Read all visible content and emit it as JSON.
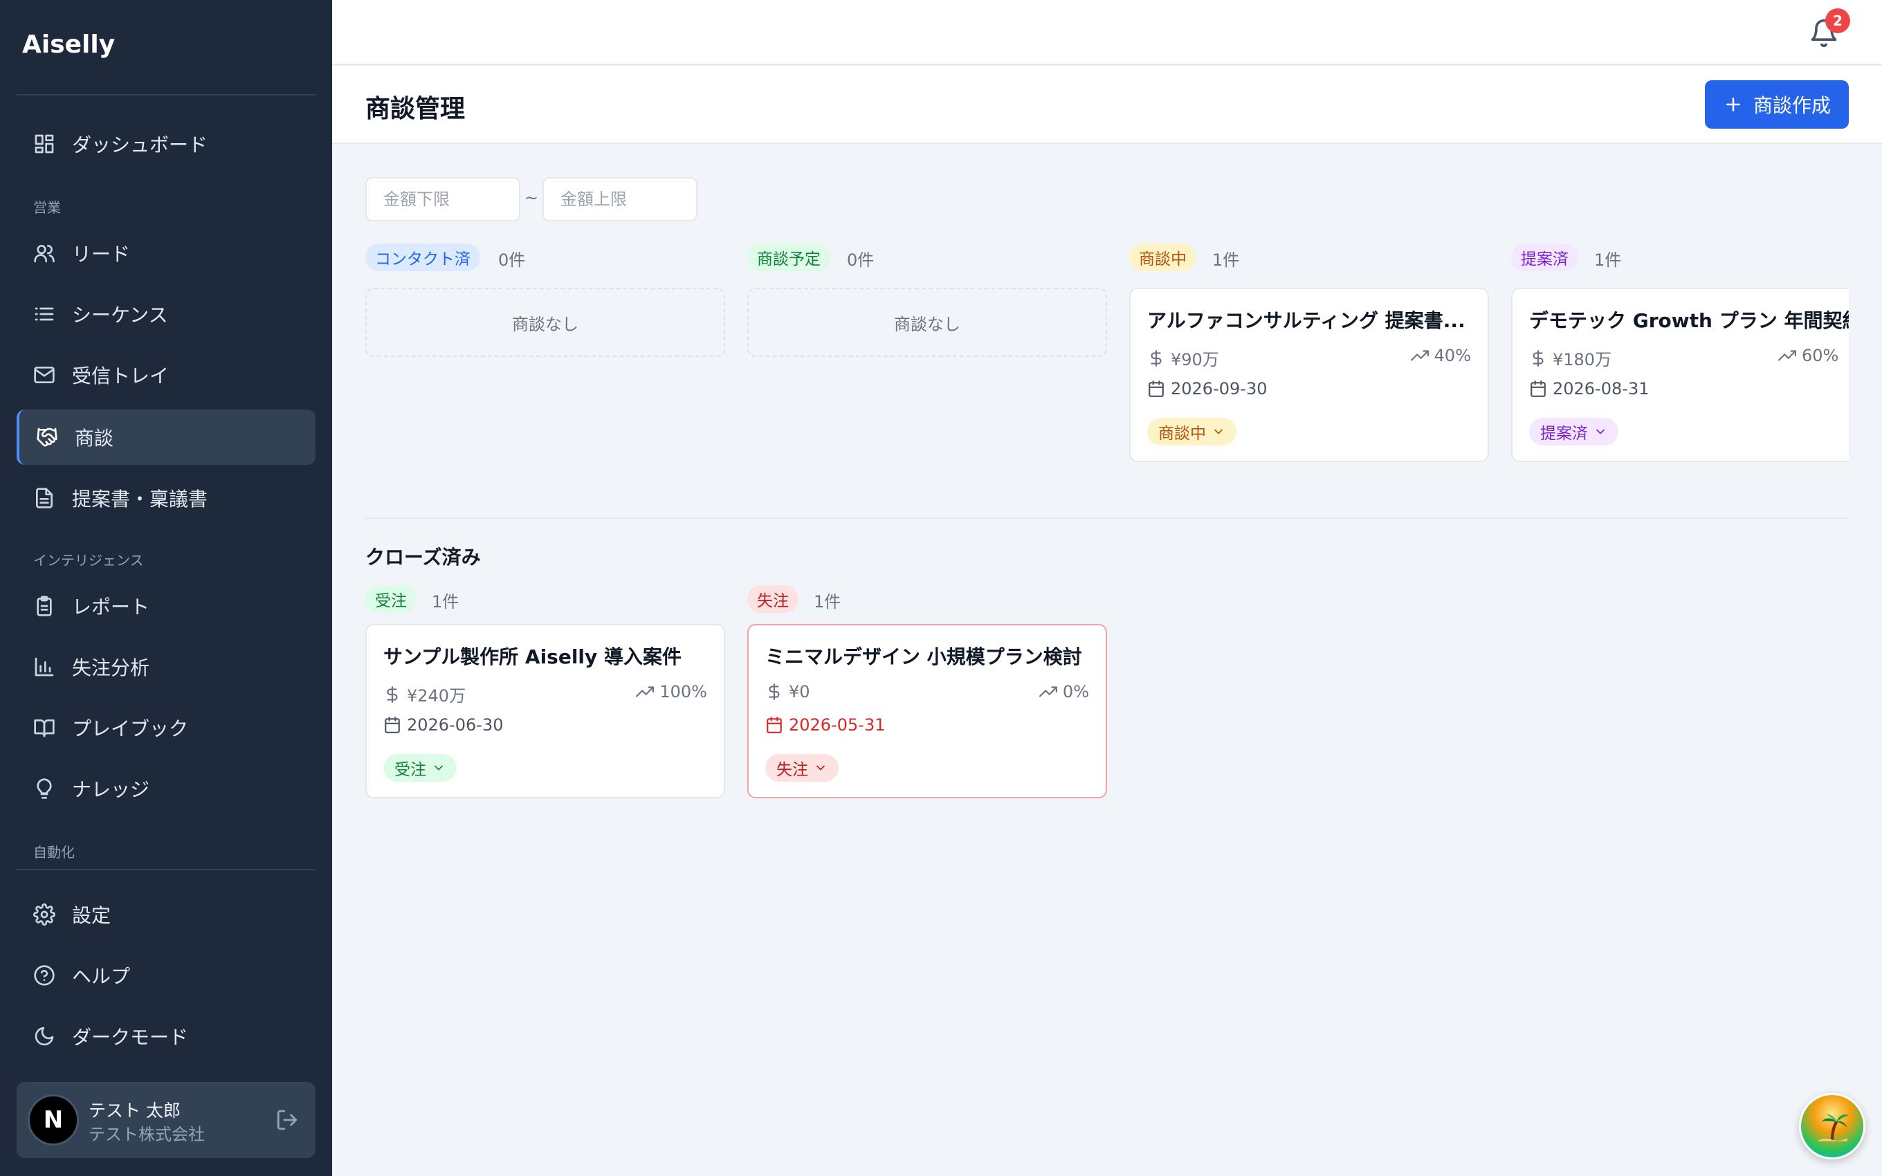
{
  "app": {
    "brand": "Aiselly"
  },
  "sidebar": {
    "dashboard": "ダッシュボード",
    "sections": {
      "sales": "営業",
      "intelligence": "インテリジェンス",
      "automation": "自動化"
    },
    "items": {
      "leads": "リード",
      "sequences": "シーケンス",
      "inbox": "受信トレイ",
      "deals": "商談",
      "proposals": "提案書・稟議書",
      "reports": "レポート",
      "loss_analysis": "失注分析",
      "playbook": "プレイブック",
      "knowledge": "ナレッジ",
      "settings": "設定",
      "help": "ヘルプ",
      "dark_mode": "ダークモード"
    },
    "active_item": "deals",
    "user": {
      "avatar_letter": "N",
      "name": "テスト 太郎",
      "company": "テスト株式会社"
    }
  },
  "topbar": {
    "notification_count": "2"
  },
  "page": {
    "title": "商談管理",
    "create_button": "商談作成"
  },
  "filters": {
    "min_placeholder": "金額下限",
    "separator": "~",
    "max_placeholder": "金額上限"
  },
  "pipeline": {
    "empty_text": "商談なし",
    "columns": [
      {
        "label": "コンタクト済",
        "count": "0件",
        "color": "#dbeafe",
        "text_color": "#2563eb"
      },
      {
        "label": "商談予定",
        "count": "0件",
        "color": "#dcfce7",
        "text_color": "#15803d"
      },
      {
        "label": "商談中",
        "count": "1件",
        "color": "#fef3c7",
        "text_color": "#b45309"
      },
      {
        "label": "提案済",
        "count": "1件",
        "color": "#f3e8ff",
        "text_color": "#7e22ce"
      }
    ],
    "cards": [
      {
        "title": "アルファコンサルティング 提案書...",
        "amount": "¥90万",
        "probability": "40%",
        "date": "2026-09-30",
        "status": "商談中"
      },
      {
        "title": "デモテック Growth プラン 年間契約",
        "amount": "¥180万",
        "probability": "60%",
        "date": "2026-08-31",
        "status": "提案済"
      }
    ]
  },
  "closed": {
    "title": "クローズ済み",
    "columns": [
      {
        "label": "受注",
        "count": "1件",
        "color": "#dcfce7",
        "text_color": "#15803d"
      },
      {
        "label": "失注",
        "count": "1件",
        "color": "#fee2e2",
        "text_color": "#b91c1c"
      }
    ],
    "cards": [
      {
        "title": "サンプル製作所 Aiselly 導入案件",
        "amount": "¥240万",
        "probability": "100%",
        "date": "2026-06-30",
        "status": "受注"
      },
      {
        "title": "ミニマルデザイン 小規模プラン検討",
        "amount": "¥0",
        "probability": "0%",
        "date": "2026-05-31",
        "status": "失注"
      }
    ]
  }
}
